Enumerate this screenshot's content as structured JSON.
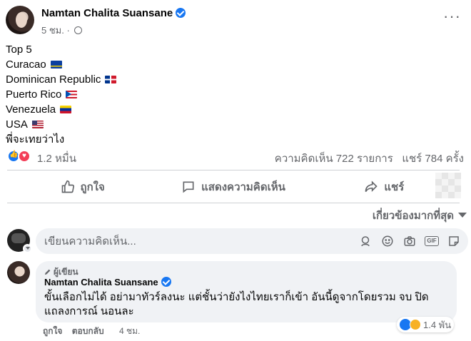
{
  "post": {
    "author": "Namtan Chalita Suansane",
    "time": "5 ชม.",
    "lines": [
      {
        "text": "Top 5"
      },
      {
        "text": "Curacao",
        "flag": "flag-cw"
      },
      {
        "text": "Dominican Republic",
        "flag": "flag-do"
      },
      {
        "text": "Puerto Rico",
        "flag": "flag-pr"
      },
      {
        "text": "Venezuela",
        "flag": "flag-ve"
      },
      {
        "text": "USA",
        "flag": "flag-us"
      },
      {
        "text": "พี่จะเทยว่าไง"
      }
    ]
  },
  "reactions": {
    "count": "1.2 หมื่น",
    "comments": "ความคิดเห็น 722 รายการ",
    "shares": "แชร์ 784 ครั้ง"
  },
  "actions": {
    "like": "ถูกใจ",
    "comment": "แสดงความคิดเห็น",
    "share": "แชร์"
  },
  "comments_section": {
    "sort_label": "เกี่ยวข้องมากที่สุด",
    "compose_placeholder": "เขียนความคิดเห็น...",
    "gif_label": "GIF"
  },
  "comment": {
    "badge": "ผู้เขียน",
    "author": "Namtan Chalita Suansane",
    "text": "ขั้นเลือกไม่ได้ อย่ามาทัวร์ลงนะ แต่ชั้นว่ายังไงไทยเราก็เข้า อันนี้ดูจากโดยรวม จบ ปิดแถลงการณ์ นอนละ",
    "reaction_count": "1.4 พัน",
    "like_label": "ถูกใจ",
    "reply_label": "ตอบกลับ",
    "time": "4 ชม."
  },
  "colors": {
    "accent": "#1877f2",
    "secondary_text": "#65676b",
    "love": "#f33e58"
  }
}
